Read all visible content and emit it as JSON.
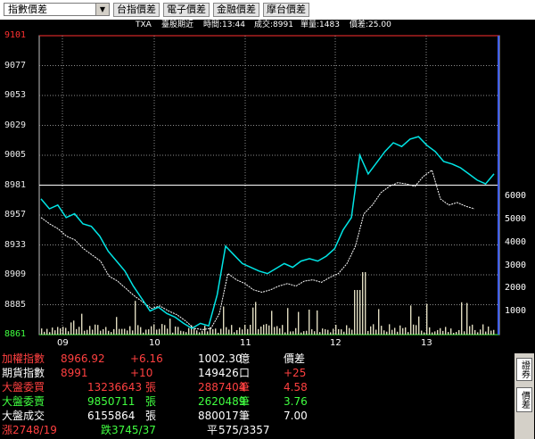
{
  "toolbar": {
    "selector_value": "指數價差",
    "buttons": [
      "台指價差",
      "電子價差",
      "金融價差",
      "摩台價差"
    ]
  },
  "info_bar": {
    "symbol": "TXA",
    "name": "臺股期近",
    "time": "時間:13:44",
    "volume": "成交:8991",
    "unit_vol": "單量:1483",
    "spread": "價差:25.00"
  },
  "chart": {
    "y_ticks": [
      "9101",
      "9077",
      "9053",
      "9029",
      "9005",
      "8981",
      "8957",
      "8933",
      "8909",
      "8885",
      "8861"
    ],
    "volume_ticks": [
      "6000",
      "5000",
      "4000",
      "3000",
      "2000",
      "1000"
    ],
    "x_ticks": [
      "09",
      "10",
      "11",
      "12",
      "13"
    ],
    "colors": {
      "index": "#ffffff",
      "futures": "#00e5e5",
      "volume": "#e0dcc0",
      "top": "#ff3030",
      "bottom": "#40ff40"
    }
  },
  "chart_data": {
    "type": "line",
    "x_ticks": [
      "09",
      "10",
      "11",
      "12",
      "13"
    ],
    "ylim": [
      8861,
      9101
    ],
    "y_tick_labels": [
      "9101",
      "9077",
      "9053",
      "9029",
      "9005",
      "8981",
      "8957",
      "8933",
      "8909",
      "8885",
      "8861"
    ],
    "volume_axis": [
      1000,
      2000,
      3000,
      4000,
      5000,
      6000
    ],
    "series": [
      {
        "values": [
          8970,
          8962,
          8965,
          8955,
          8958,
          8950,
          8948,
          8940,
          8928,
          8920,
          8912,
          8900,
          8890,
          8880,
          8883,
          8878,
          8875,
          8870,
          8866,
          8870,
          8868,
          8893,
          8932,
          8925,
          8918,
          8915,
          8912,
          8910,
          8914,
          8918,
          8915,
          8920,
          8922,
          8920,
          8924,
          8930,
          8945,
          8955,
          9005,
          8990,
          8999,
          9008,
          9015,
          9012,
          9018,
          9020,
          9013,
          9008,
          9000,
          8998,
          8995,
          8990,
          8985,
          8982,
          8990
        ]
      },
      {
        "values": [
          8955,
          8950,
          8946,
          8940,
          8937,
          8930,
          8925,
          8920,
          8908,
          8904,
          8898,
          8892,
          8887,
          8882,
          8884,
          8880,
          8877,
          8872,
          8866,
          8865,
          8866,
          8878,
          8910,
          8905,
          8902,
          8897,
          8895,
          8897,
          8900,
          8902,
          8900,
          8904,
          8905,
          8903,
          8907,
          8910,
          8918,
          8932,
          8958,
          8965,
          8975,
          8980,
          8983,
          8982,
          8980,
          8988,
          8993,
          8970,
          8965,
          8967,
          8964,
          8962
        ]
      }
    ]
  },
  "panel": {
    "rows": [
      {
        "label": "加權指數",
        "v1": "8966.92",
        "v2": "+6.16",
        "v3": "1002.30",
        "u3": "億",
        "v4": "價差"
      },
      {
        "label": "期貨指數",
        "v1": "8991",
        "v2": "+10",
        "v3": "149426",
        "u3": "口",
        "v4": "+25"
      },
      {
        "label": "大盤委買",
        "v1": "13236643",
        "u1": "張",
        "v3": "2887404",
        "u3": "筆",
        "v4": "4.58"
      },
      {
        "label": "大盤委賣",
        "v1": "9850711",
        "u1": "張",
        "v3": "2620489",
        "u3": "筆",
        "v4": "3.76"
      },
      {
        "label": "大盤成交",
        "v1": "6155864",
        "u1": "張",
        "v3": "880017",
        "u3": "筆",
        "v4": "7.00"
      }
    ],
    "bottom": {
      "up": "漲2748/19",
      "down": "跌3745/37",
      "flat_label": "平",
      "flat": "575/3357"
    }
  },
  "side_buttons": [
    "證券",
    "價差"
  ]
}
